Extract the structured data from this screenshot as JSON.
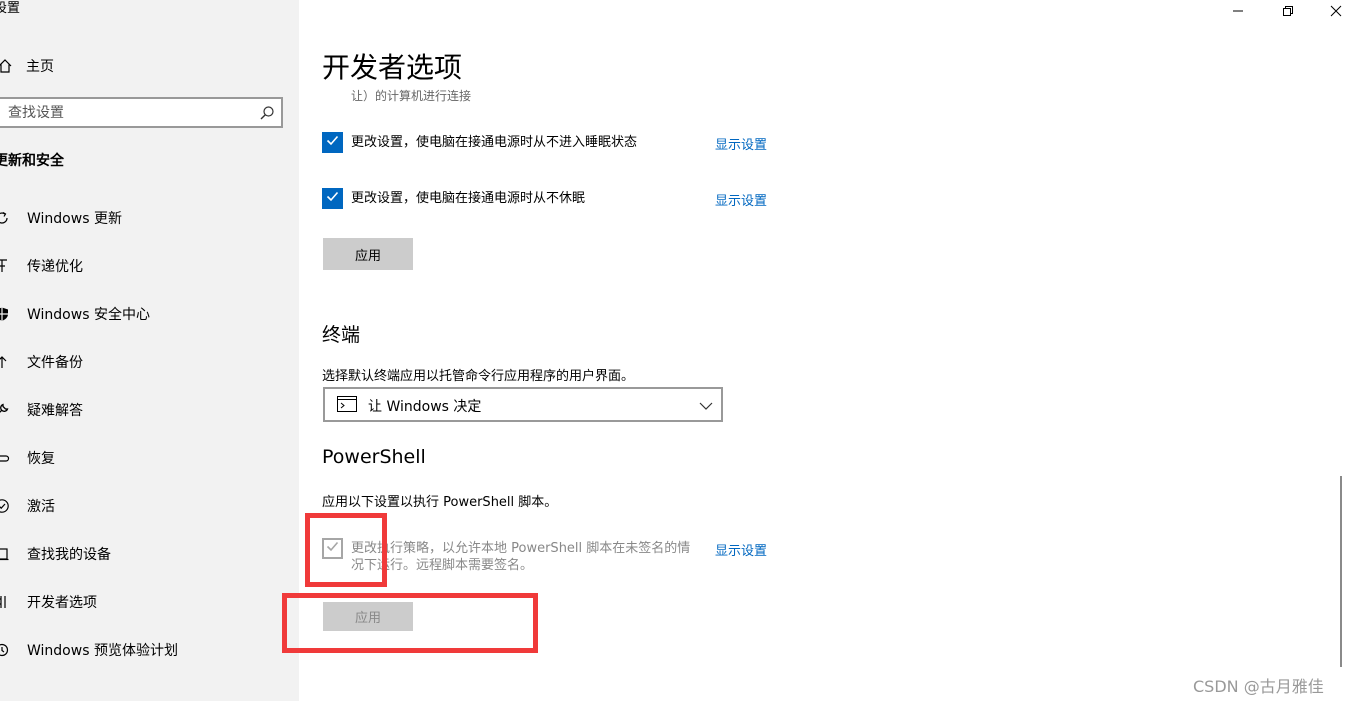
{
  "window": {
    "app_title": "设置"
  },
  "sidebar": {
    "home_label": "主页",
    "search_placeholder": "查找设置",
    "section_title": "更新和安全",
    "items": [
      {
        "label": "Windows 更新",
        "icon": "sync-icon"
      },
      {
        "label": "传递优化",
        "icon": "delivery-optimization-icon"
      },
      {
        "label": "Windows 安全中心",
        "icon": "shield-icon"
      },
      {
        "label": "文件备份",
        "icon": "backup-arrow-icon"
      },
      {
        "label": "疑难解答",
        "icon": "wrench-icon"
      },
      {
        "label": "恢复",
        "icon": "recovery-icon"
      },
      {
        "label": "激活",
        "icon": "check-circle-icon"
      },
      {
        "label": "查找我的设备",
        "icon": "find-device-icon"
      },
      {
        "label": "开发者选项",
        "icon": "developer-tools-icon"
      },
      {
        "label": "Windows 预览体验计划",
        "icon": "insider-icon"
      }
    ]
  },
  "main": {
    "page_title": "开发者选项",
    "truncated_text": "让）的计算机进行连接",
    "remote_options": [
      {
        "label": "更改设置，使电脑在接通电源时从不进入睡眠状态",
        "link": "显示设置",
        "checked": true
      },
      {
        "label": "更改设置，使电脑在接通电源时从不休眠",
        "link": "显示设置",
        "checked": true
      }
    ],
    "apply_label": "应用",
    "terminal": {
      "heading": "终端",
      "description": "选择默认终端应用以托管命令行应用程序的用户界面。",
      "selected_value": "让 Windows 决定"
    },
    "powershell": {
      "heading": "PowerShell",
      "description": "应用以下设置以执行 PowerShell 脚本。",
      "option_label": "更改执行策略，以允许本地 PowerShell 脚本在未签名的情况下运行。远程脚本需要签名。",
      "option_checked": true,
      "option_disabled": true,
      "link": "显示设置",
      "apply_label": "应用"
    }
  },
  "colors": {
    "accent": "#0067c0",
    "annotation": "#f03a3a",
    "sidebar_bg": "#f2f2f2"
  },
  "watermark": "CSDN @古月雅佳"
}
